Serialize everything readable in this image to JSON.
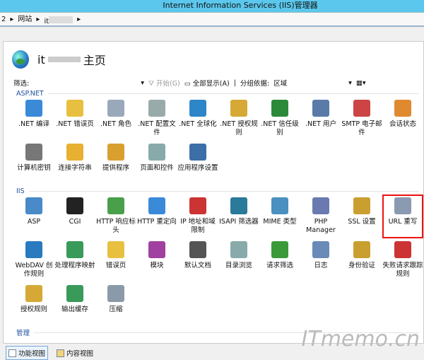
{
  "window": {
    "title": "Internet Information Services (IIS)管理器"
  },
  "breadcrumb": [
    "2",
    "网站",
    "it"
  ],
  "header": {
    "title_prefix": "it",
    "title_suffix": "主页"
  },
  "toolbar": {
    "filter_label": "筛选:",
    "start": "开始(G)",
    "show_all": "全部显示(A)",
    "group_by_label": "分组依据:",
    "group_by_value": "区域"
  },
  "sections": [
    {
      "title": "ASP.NET",
      "items": [
        {
          "label": ".NET 编译",
          "icon": "download-stack-icon",
          "color": "#3a8ad8"
        },
        {
          "label": ".NET 错误页",
          "icon": "error-404-icon",
          "color": "#e8c040"
        },
        {
          "label": ".NET 角色",
          "icon": "documents-icon",
          "color": "#9aa8bb"
        },
        {
          "label": ".NET 配置文件",
          "icon": "config-windows-icon",
          "color": "#9aa"
        },
        {
          "label": ".NET 全球化",
          "icon": "globe-icon",
          "color": "#2d86c8"
        },
        {
          "label": ".NET 授权规则",
          "icon": "lock-document-icon",
          "color": "#d6a936"
        },
        {
          "label": ".NET 信任级别",
          "icon": "globe-check-icon",
          "color": "#2a8a3a"
        },
        {
          "label": ".NET 用户",
          "icon": "user-icon",
          "color": "#5a7aa8"
        },
        {
          "label": "SMTP 电子邮件",
          "icon": "email-icon",
          "color": "#c44"
        },
        {
          "label": "会话状态",
          "icon": "session-user-icon",
          "color": "#e08a30"
        },
        {
          "label": "计算机密钥",
          "icon": "server-key-icon",
          "color": "#777"
        },
        {
          "label": "连接字符串",
          "icon": "database-ab-icon",
          "color": "#e8b030"
        },
        {
          "label": "提供程序",
          "icon": "database-user-icon",
          "color": "#d9a030"
        },
        {
          "label": "页面和控件",
          "icon": "page-controls-icon",
          "color": "#8aa"
        },
        {
          "label": "应用程序设置",
          "icon": "checklist-icon",
          "color": "#3c6ea8"
        }
      ]
    },
    {
      "title": "IIS",
      "items": [
        {
          "label": "ASP",
          "icon": "asp-gear-icon",
          "color": "#4a8ac8"
        },
        {
          "label": "CGI",
          "icon": "cgi-icon",
          "color": "#222"
        },
        {
          "label": "HTTP 响应标头",
          "icon": "http-headers-icon",
          "color": "#4aa04a"
        },
        {
          "label": "HTTP 重定向",
          "icon": "redirect-icon",
          "color": "#3a8ad8"
        },
        {
          "label": "IP 地址和域限制",
          "icon": "ip-restrict-icon",
          "color": "#c33"
        },
        {
          "label": "ISAPI 筛选器",
          "icon": "isapi-filter-icon",
          "color": "#2a7a9a"
        },
        {
          "label": "MIME 类型",
          "icon": "mime-icon",
          "color": "#4a90c0"
        },
        {
          "label": "PHP Manager",
          "icon": "php-icon",
          "color": "#6a7ab0"
        },
        {
          "label": "SSL 设置",
          "icon": "padlock-icon",
          "color": "#c9a030"
        },
        {
          "label": "URL 重写",
          "icon": "url-rewrite-icon",
          "color": "#8a9ab0",
          "selected": true
        },
        {
          "label": "WebDAV 创作规则",
          "icon": "webdav-icon",
          "color": "#2a7ac0"
        },
        {
          "label": "处理程序映射",
          "icon": "handler-mapping-icon",
          "color": "#3a9a5a"
        },
        {
          "label": "错误页",
          "icon": "error-404-icon",
          "color": "#e8c040"
        },
        {
          "label": "模块",
          "icon": "modules-icon",
          "color": "#a040a0"
        },
        {
          "label": "默认文档",
          "icon": "default-document-icon",
          "color": "#555"
        },
        {
          "label": "目录浏览",
          "icon": "directory-browse-icon",
          "color": "#8aa"
        },
        {
          "label": "请求筛选",
          "icon": "request-filter-icon",
          "color": "#3a9a3a"
        },
        {
          "label": "日志",
          "icon": "log-icon",
          "color": "#6a8ab8"
        },
        {
          "label": "身份验证",
          "icon": "authentication-icon",
          "color": "#c9a030"
        },
        {
          "label": "失败请求跟踪规则",
          "icon": "failed-request-icon",
          "color": "#c33"
        },
        {
          "label": "授权规则",
          "icon": "lock-document-icon",
          "color": "#d6a936"
        },
        {
          "label": "输出缓存",
          "icon": "output-cache-icon",
          "color": "#3a9a5a"
        },
        {
          "label": "压缩",
          "icon": "compression-icon",
          "color": "#8a9aa8"
        }
      ]
    },
    {
      "title": "管理",
      "items": []
    }
  ],
  "bottom": {
    "features_view": "功能视图",
    "content_view": "内容视图"
  },
  "watermark": "ITmemo.cn"
}
